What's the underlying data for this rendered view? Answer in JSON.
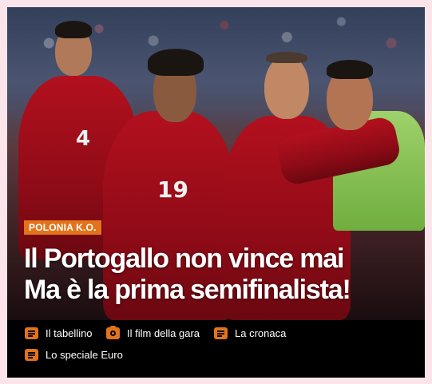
{
  "story": {
    "kicker": "POLONIA K.O.",
    "headline_line1": "Il Portogallo non vince mai",
    "headline_line2": "Ma è la prima semifinalista!",
    "player_numbers": [
      "4",
      "19"
    ]
  },
  "links": [
    {
      "label": "Il tabellino",
      "icon": "document-icon"
    },
    {
      "label": "Il film della gara",
      "icon": "camera-icon"
    },
    {
      "label": "La cronaca",
      "icon": "document-icon"
    },
    {
      "label": "Lo speciale Euro",
      "icon": "document-icon"
    }
  ],
  "colors": {
    "accent": "#e3731b",
    "background": "#000000",
    "page": "#fbe4ea",
    "jersey": "#b3101e"
  }
}
